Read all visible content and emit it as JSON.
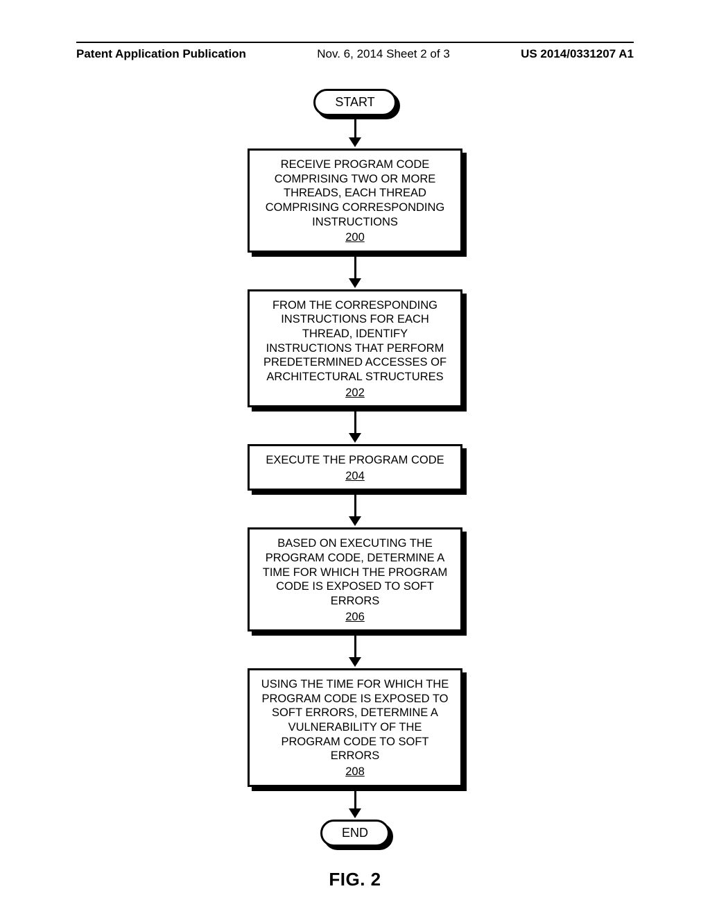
{
  "header": {
    "left": "Patent Application Publication",
    "mid": "Nov. 6, 2014  Sheet 2 of 3",
    "right": "US 2014/0331207 A1"
  },
  "flowchart": {
    "start": "START",
    "steps": [
      {
        "text": "RECEIVE PROGRAM CODE COMPRISING TWO OR MORE THREADS, EACH THREAD COMPRISING CORRESPONDING INSTRUCTIONS",
        "ref": "200"
      },
      {
        "text": "FROM THE CORRESPONDING INSTRUCTIONS FOR EACH THREAD, IDENTIFY INSTRUCTIONS THAT PERFORM PREDETERMINED ACCESSES OF ARCHITECTURAL STRUCTURES",
        "ref": "202"
      },
      {
        "text": "EXECUTE THE PROGRAM CODE",
        "ref": "204"
      },
      {
        "text": "BASED ON EXECUTING THE PROGRAM CODE, DETERMINE A TIME FOR WHICH THE PROGRAM CODE IS EXPOSED TO SOFT ERRORS",
        "ref": "206"
      },
      {
        "text": "USING THE TIME FOR WHICH THE PROGRAM CODE IS EXPOSED TO SOFT ERRORS, DETERMINE A VULNERABILITY OF THE PROGRAM CODE TO SOFT ERRORS",
        "ref": "208"
      }
    ],
    "end": "END"
  },
  "figure_label": "FIG. 2"
}
